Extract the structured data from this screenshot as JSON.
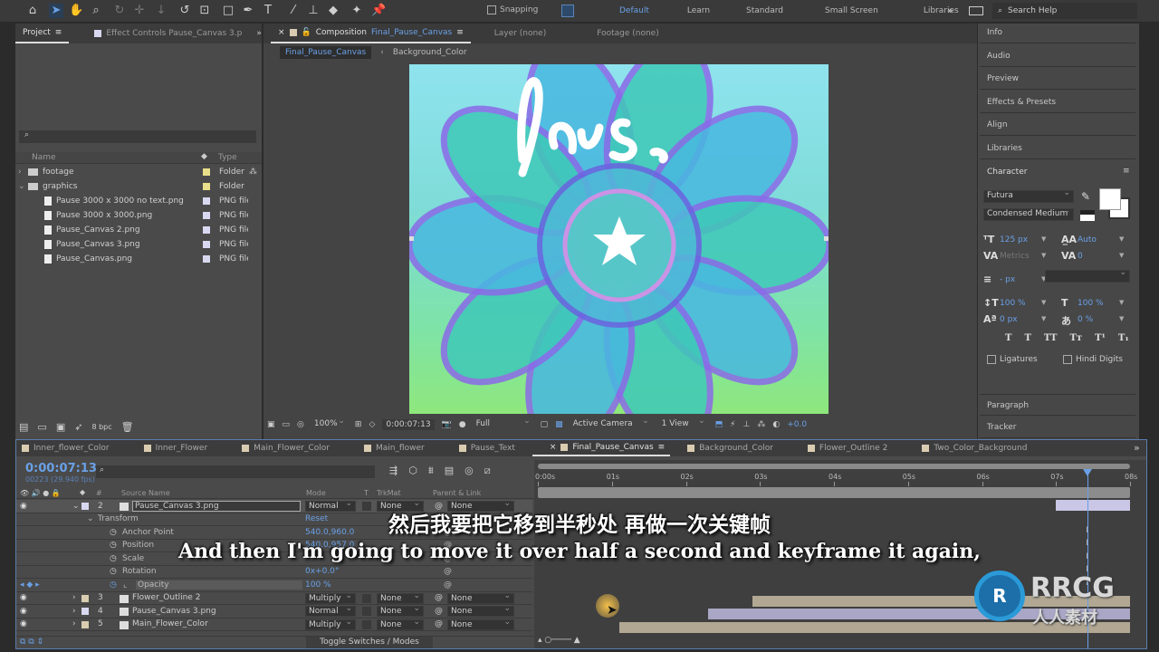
{
  "toolbar": {
    "tools": [
      "home-icon",
      "selection-icon",
      "hand-icon",
      "zoom-icon",
      "orbit-icon",
      "pan-icon",
      "dolly-icon",
      "rotate-icon",
      "anchor-icon",
      "rectangle-icon",
      "pen-icon",
      "type-icon",
      "brush-icon",
      "clone-stamp-icon",
      "eraser-icon",
      "roto-brush-icon",
      "puppet-pin-icon"
    ],
    "snapping_label": "Snapping",
    "workspaces": [
      "Default",
      "Learn",
      "Standard",
      "Small Screen",
      "Libraries"
    ],
    "active_workspace": "Default",
    "search_placeholder": "Search Help"
  },
  "project_panel": {
    "tab_project": "Project",
    "tab_effect_controls": "Effect Controls Pause_Canvas 3.p",
    "col_name": "Name",
    "col_type": "Type",
    "items": [
      {
        "name": "footage",
        "type": "Folder",
        "kind": "folder",
        "expanded": false,
        "indent": 0,
        "color": "#e8df8a"
      },
      {
        "name": "graphics",
        "type": "Folder",
        "kind": "folder",
        "expanded": true,
        "indent": 0,
        "color": "#e8df8a"
      },
      {
        "name": "Pause 3000 x 3000 no text.png",
        "type": "PNG file",
        "kind": "file",
        "indent": 1,
        "color": "#d8d8f0"
      },
      {
        "name": "Pause 3000 x 3000.png",
        "type": "PNG file",
        "kind": "file",
        "indent": 1,
        "color": "#d8d8f0"
      },
      {
        "name": "Pause_Canvas 2.png",
        "type": "PNG file",
        "kind": "file",
        "indent": 1,
        "color": "#d8d8f0"
      },
      {
        "name": "Pause_Canvas 3.png",
        "type": "PNG file",
        "kind": "file",
        "indent": 1,
        "color": "#d8d8f0"
      },
      {
        "name": "Pause_Canvas.png",
        "type": "PNG file",
        "kind": "file",
        "indent": 1,
        "color": "#d8d8f0"
      }
    ],
    "bpc": "8 bpc"
  },
  "composition_panel": {
    "tab_prefix": "Composition",
    "tab_name": "Final_Pause_Canvas",
    "tab_layer": "Layer (none)",
    "tab_footage": "Footage (none)",
    "breadcrumb": [
      "Final_Pause_Canvas",
      "Background_Color"
    ],
    "viewer_text": "Paus.",
    "footer": {
      "zoom": "100%",
      "timecode": "0:00:07:13",
      "resolution": "Full",
      "camera": "Active Camera",
      "views": "1 View",
      "exposure": "+0.0"
    }
  },
  "right_panel": {
    "collapsed": [
      "Info",
      "Audio",
      "Preview",
      "Effects & Presets",
      "Align",
      "Libraries"
    ],
    "character": {
      "title": "Character",
      "font": "Futura",
      "style": "Condensed Medium",
      "size": "125 px",
      "leading": "Auto",
      "kerning": "Metrics",
      "tracking": "0",
      "stroke_width": "- px",
      "vert_scale": "100 %",
      "horiz_scale": "100 %",
      "baseline_shift": "0 px",
      "tsume": "0 %",
      "style_buttons": [
        "T",
        "T",
        "TT",
        "Tт",
        "T¹",
        "T₁"
      ],
      "ligatures_label": "Ligatures",
      "hindi_digits_label": "Hindi Digits",
      "fill_color": "#ffffff"
    },
    "paragraph": "Paragraph",
    "tracker": "Tracker"
  },
  "timeline": {
    "tabs": [
      {
        "name": "Inner_flower_Color",
        "color": "#d9ccb0"
      },
      {
        "name": "Inner_Flower",
        "color": "#d9ccb0"
      },
      {
        "name": "Main_Flower_Color",
        "color": "#d9ccb0"
      },
      {
        "name": "Main_flower",
        "color": "#d9ccb0"
      },
      {
        "name": "Pause_Text",
        "color": "#d9ccb0"
      },
      {
        "name": "Final_Pause_Canvas",
        "color": "#d9ccb0",
        "active": true
      },
      {
        "name": "Background_Color",
        "color": "#d9ccb0"
      },
      {
        "name": "Flower_Outline 2",
        "color": "#d9ccb0"
      },
      {
        "name": "Two_Color_Background",
        "color": "#d9ccb0"
      }
    ],
    "current_time": "0:00:07:13",
    "frame_info": "00223 (29.940 fps)",
    "headers": {
      "num": "#",
      "source": "Source Name",
      "mode": "Mode",
      "t": "T",
      "trkmat": "TrkMat",
      "parent": "Parent & Link"
    },
    "ruler": [
      "0:00s",
      "01s",
      "02s",
      "03s",
      "04s",
      "05s",
      "06s",
      "07s",
      "08s"
    ],
    "playhead_seconds": 7.43,
    "duration_seconds": 8,
    "layers": [
      {
        "num": "2",
        "name": "Pause_Canvas 3.png",
        "mode": "Normal",
        "trkmat": "None",
        "parent": "None",
        "color": "#d8d8f0",
        "selected": true,
        "expanded": true,
        "start": 7.0,
        "end": 8.0,
        "bar_color": "#c9c6e6"
      },
      {
        "num": "3",
        "name": "Flower_Outline 2",
        "mode": "Multiply",
        "trkmat": "None",
        "parent": "None",
        "color": "#d9ccb0",
        "start": 2.9,
        "end": 8.0,
        "bar_color": "#b1a793"
      },
      {
        "num": "4",
        "name": "Pause_Canvas 3.png",
        "mode": "Normal",
        "trkmat": "None",
        "parent": "None",
        "color": "#d8d8f0",
        "start": 2.3,
        "end": 8.0,
        "bar_color": "#a9a6c6"
      },
      {
        "num": "5",
        "name": "Main_Flower_Color",
        "mode": "Multiply",
        "trkmat": "None",
        "parent": "None",
        "color": "#d9ccb0",
        "start": 1.1,
        "end": 8.0,
        "bar_color": "#b1a793"
      }
    ],
    "transform": {
      "label": "Transform",
      "reset": "Reset",
      "props": [
        {
          "name": "Anchor Point",
          "value": "540.0,960.0"
        },
        {
          "name": "Position",
          "value": "540.0,957.0"
        },
        {
          "name": "Scale",
          "value": ""
        },
        {
          "name": "Rotation",
          "value": "0x+0.0°"
        },
        {
          "name": "Opacity",
          "value": "100 %",
          "active": true
        }
      ]
    },
    "toggle_label": "Toggle Switches / Modes"
  },
  "subtitles": {
    "chinese": "然后我要把它移到半秒处 再做一次关键帧",
    "english": "And then I'm going to move it over half a second and keyframe it again,"
  },
  "watermark": {
    "brand": "RRCG",
    "sub": "人人素材"
  }
}
